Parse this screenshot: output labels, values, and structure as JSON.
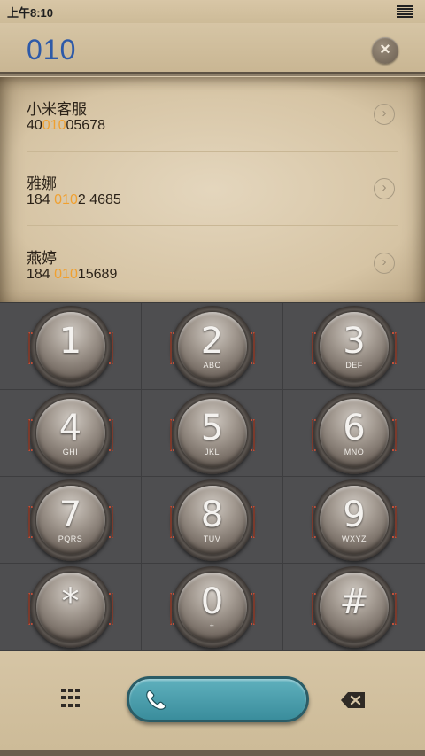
{
  "status_bar": {
    "time": "上午8:10"
  },
  "dialer": {
    "number": "010",
    "clear_label": "×"
  },
  "contacts": [
    {
      "name": "小米客服",
      "phone_prefix": "40",
      "phone_match": "010",
      "phone_suffix": "05678"
    },
    {
      "name": "雅娜",
      "phone_prefix": "184 ",
      "phone_match": "010",
      "phone_suffix": "2 4685"
    },
    {
      "name": "燕婷",
      "phone_prefix": "184 ",
      "phone_match": "010",
      "phone_suffix": "15689"
    }
  ],
  "keypad": [
    {
      "digit": "1",
      "letters": ""
    },
    {
      "digit": "2",
      "letters": "ABC"
    },
    {
      "digit": "3",
      "letters": "DEF"
    },
    {
      "digit": "4",
      "letters": "GHI"
    },
    {
      "digit": "5",
      "letters": "JKL"
    },
    {
      "digit": "6",
      "letters": "MNO"
    },
    {
      "digit": "7",
      "letters": "PQRS"
    },
    {
      "digit": "8",
      "letters": "TUV"
    },
    {
      "digit": "9",
      "letters": "WXYZ"
    },
    {
      "digit": "*",
      "letters": ""
    },
    {
      "digit": "0",
      "letters": "+"
    },
    {
      "digit": "#",
      "letters": ""
    }
  ],
  "colors": {
    "dial_number": "#2e5aa8",
    "match_highlight": "#f0a030",
    "call_button": "#3a8d9c",
    "keypad_bg": "#4e4e50"
  },
  "icons": {
    "clear": "close-icon",
    "detail": "chevron-right-icon",
    "dialpad": "dialpad-icon",
    "call": "phone-icon",
    "backspace": "backspace-icon"
  }
}
